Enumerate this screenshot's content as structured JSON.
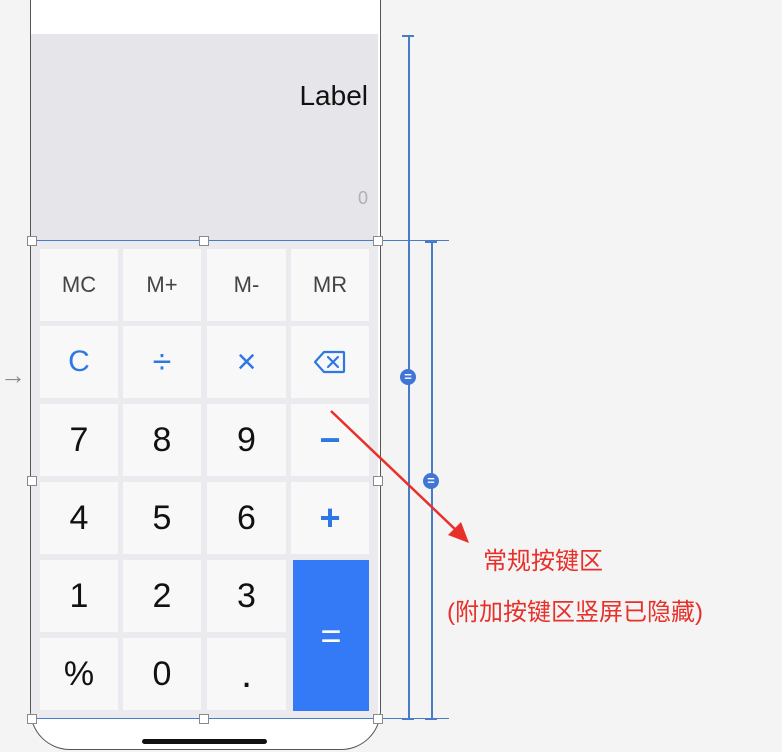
{
  "display": {
    "label": "Label",
    "value": "0"
  },
  "keys": {
    "mc": "MC",
    "mplus": "M+",
    "mminus": "M-",
    "mr": "MR",
    "clear": "C",
    "divide": "÷",
    "multiply": "×",
    "seven": "7",
    "eight": "8",
    "nine": "9",
    "minus": "−",
    "four": "4",
    "five": "5",
    "six": "6",
    "plus": "+",
    "one": "1",
    "two": "2",
    "three": "3",
    "equals": "=",
    "percent": "%",
    "zero": "0",
    "dot": "."
  },
  "annotation": {
    "line1": "常规按键区",
    "line2": "(附加按键区竖屏已隐藏)"
  },
  "colors": {
    "accent": "#3479f6",
    "annotation": "#e8302a",
    "guide": "#4a7bc8"
  },
  "icons": {
    "backspace": "backspace-icon",
    "entry": "entry-arrow-icon"
  }
}
